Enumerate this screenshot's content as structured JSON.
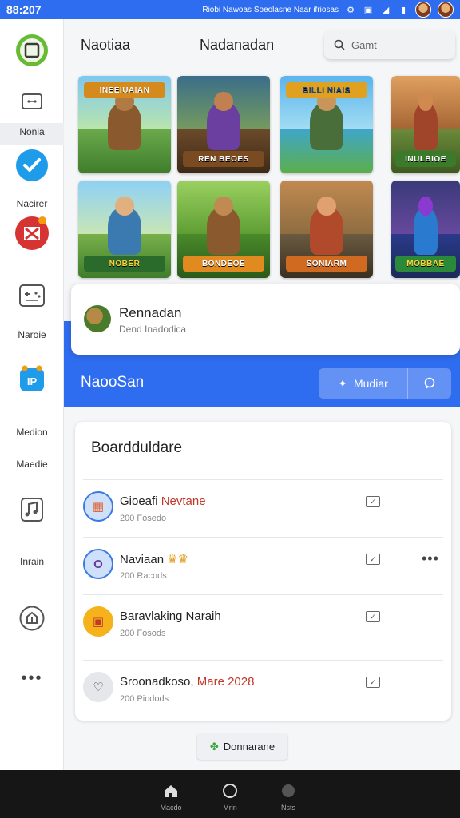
{
  "status_bar": {
    "time": "88:207",
    "text": "Riobi Nawoas Soeolasne Naar ifriosas"
  },
  "rail": {
    "labels": [
      "Nonia",
      "Nacirer",
      "Naroie",
      "Medion",
      "Maedie",
      "Inrain"
    ]
  },
  "header": {
    "title": "Naotiaa",
    "subtitle": "Nadanadan",
    "search_placeholder": "Gamt"
  },
  "tiles": [
    {
      "label": "INEEIUAIAN"
    },
    {
      "label": "REN BEOES"
    },
    {
      "label": "BILLI NIAIS"
    },
    {
      "label": "INULBIOE"
    },
    {
      "label": "NOBER"
    },
    {
      "label": "BONDEOE"
    },
    {
      "label": "SONIARM"
    },
    {
      "label": "MOBBAE"
    }
  ],
  "popup": {
    "title": "Rennadan",
    "subtitle": "Dend Inadodica"
  },
  "band": {
    "title": "NaooSan",
    "button_label": "Mudiar"
  },
  "board": {
    "title": "Boardduldare",
    "rows": [
      {
        "name": "Gioeafi",
        "highlight": "Nevtane",
        "meta": "200 Fosedo"
      },
      {
        "name": "Naviaan",
        "highlight": "",
        "meta": "200 Racods"
      },
      {
        "name": "Baravlaking Naraih",
        "highlight": "",
        "meta": "200 Fosods"
      },
      {
        "name": "Sroonadkoso,",
        "highlight": "Mare 2028",
        "meta": "200 Piodods"
      }
    ]
  },
  "bottom_button": {
    "label": "Donnarane"
  },
  "navbar": {
    "labels": [
      "Macdo",
      "Mrin",
      "Nsts"
    ]
  }
}
